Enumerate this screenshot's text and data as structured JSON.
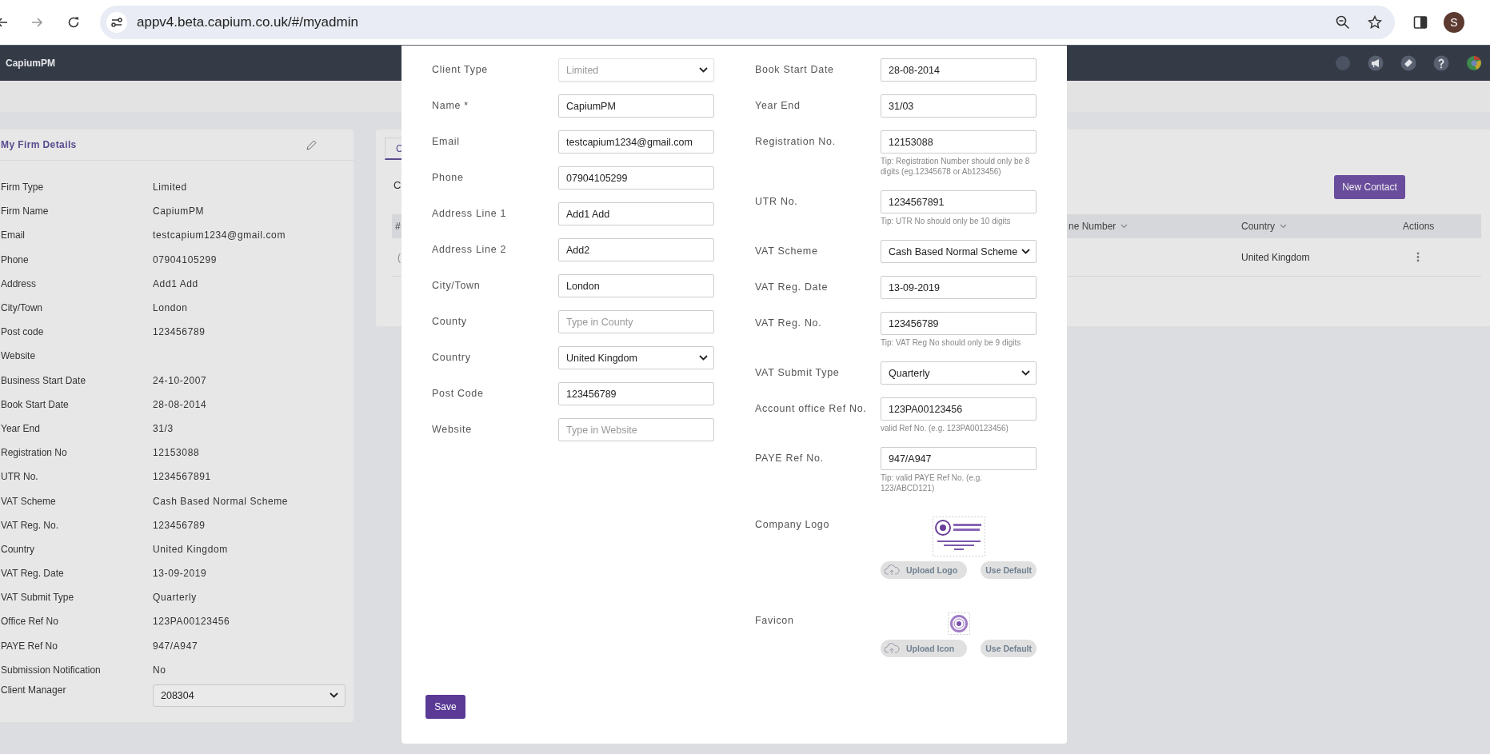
{
  "browser": {
    "url": "appv4.beta.capium.co.uk/#/myadmin",
    "avatar": "S"
  },
  "app": {
    "title": "CapiumPM"
  },
  "firm_details": {
    "title": "My Firm Details",
    "rows": [
      {
        "label": "Firm Type",
        "value": "Limited"
      },
      {
        "label": "Firm Name",
        "value": "CapiumPM"
      },
      {
        "label": "Email",
        "value": "testcapium1234@gmail.com"
      },
      {
        "label": "Phone",
        "value": "07904105299"
      },
      {
        "label": "Address",
        "value": "Add1 Add"
      },
      {
        "label": "City/Town",
        "value": "London"
      },
      {
        "label": "Post code",
        "value": "123456789"
      },
      {
        "label": "Website"
      },
      {
        "label": "Business Start Date",
        "value": "24-10-2007"
      },
      {
        "label": "Book Start Date",
        "value": "28-08-2014"
      },
      {
        "label": "Year End",
        "value": "31/3"
      },
      {
        "label": "Registration No",
        "value": "12153088"
      },
      {
        "label": "UTR No.",
        "value": "1234567891"
      },
      {
        "label": "VAT Scheme",
        "value": "Cash Based Normal Scheme"
      },
      {
        "label": "VAT Reg. No.",
        "value": "123456789"
      },
      {
        "label": "Country",
        "value": "United Kingdom"
      },
      {
        "label": "VAT Reg. Date",
        "value": "13-09-2019"
      },
      {
        "label": "VAT Submit Type",
        "value": "Quarterly"
      },
      {
        "label": "Office Ref No",
        "value": "123PA00123456"
      },
      {
        "label": "PAYE Ref No",
        "value": "947/A947"
      },
      {
        "label": "Submission Notification",
        "value": "No"
      }
    ],
    "client_manager": {
      "label": "Client Manager",
      "value": "208304"
    }
  },
  "contacts": {
    "tab": "C",
    "heading": "C",
    "new_button": "New Contact",
    "columns": [
      "#",
      "ne Number",
      "Country",
      "Actions"
    ],
    "rows": [
      {
        "cells": [
          "(",
          "",
          "United Kingdom"
        ]
      }
    ]
  },
  "modal": {
    "left_fields": [
      {
        "label": "Client Type",
        "kind": "select",
        "value": "Limited",
        "disabled": true
      },
      {
        "label": "Name *",
        "kind": "input",
        "value": "CapiumPM",
        "disabled": false
      },
      {
        "label": "Email",
        "kind": "input",
        "value": "testcapium1234@gmail.com",
        "disabled": false
      },
      {
        "label": "Phone",
        "kind": "input",
        "value": "07904105299",
        "disabled": false
      },
      {
        "label": "Address Line 1",
        "kind": "input",
        "value": "Add1 Add",
        "disabled": false
      },
      {
        "label": "Address Line 2",
        "kind": "input",
        "value": "Add2",
        "disabled": false
      },
      {
        "label": "City/Town",
        "kind": "input",
        "value": "London",
        "disabled": false
      },
      {
        "label": "County",
        "kind": "input",
        "placeholder": "Type in County",
        "disabled": false
      },
      {
        "label": "Country",
        "kind": "select",
        "value": "United Kingdom",
        "disabled": false
      },
      {
        "label": "Post Code",
        "kind": "input",
        "value": "123456789",
        "disabled": false
      },
      {
        "label": "Website",
        "kind": "input",
        "placeholder": "Type in Website",
        "disabled": false
      }
    ],
    "right_fields": [
      {
        "label": "Book Start Date",
        "kind": "input",
        "value": "28-08-2014"
      },
      {
        "label": "Year End",
        "kind": "input",
        "value": "31/03"
      },
      {
        "label": "Registration No.",
        "kind": "input",
        "value": "12153088",
        "tip": "Tip: Registration Number should only be 8 digits (eg.12345678 or Ab123456)"
      },
      {
        "label": "UTR No.",
        "kind": "input",
        "value": "1234567891",
        "tip": "Tip: UTR No should only be 10 digits"
      },
      {
        "label": "VAT Scheme",
        "kind": "select",
        "value": "Cash Based Normal Scheme"
      },
      {
        "label": "VAT Reg. Date",
        "kind": "input",
        "value": "13-09-2019"
      },
      {
        "label": "VAT Reg. No.",
        "kind": "input",
        "value": "123456789",
        "tip": "Tip: VAT Reg No should only be 9 digits"
      },
      {
        "label": "VAT Submit Type",
        "kind": "select",
        "value": "Quarterly"
      },
      {
        "label": "Account office Ref No.",
        "kind": "input",
        "value": "123PA00123456",
        "tip": "valid Ref No. (e.g. 123PA00123456)"
      },
      {
        "label": "PAYE Ref No.",
        "kind": "input",
        "value": "947/A947",
        "tip": "Tip: valid PAYE Ref No. (e.g. 123/ABCD121)"
      }
    ],
    "images": [
      {
        "label": "Company Logo",
        "kind": "logo",
        "upload": "Upload Logo",
        "default": "Use Default"
      },
      {
        "label": "Favicon",
        "kind": "favicon",
        "upload": "Upload Icon",
        "default": "Use Default"
      }
    ],
    "save": "Save"
  }
}
